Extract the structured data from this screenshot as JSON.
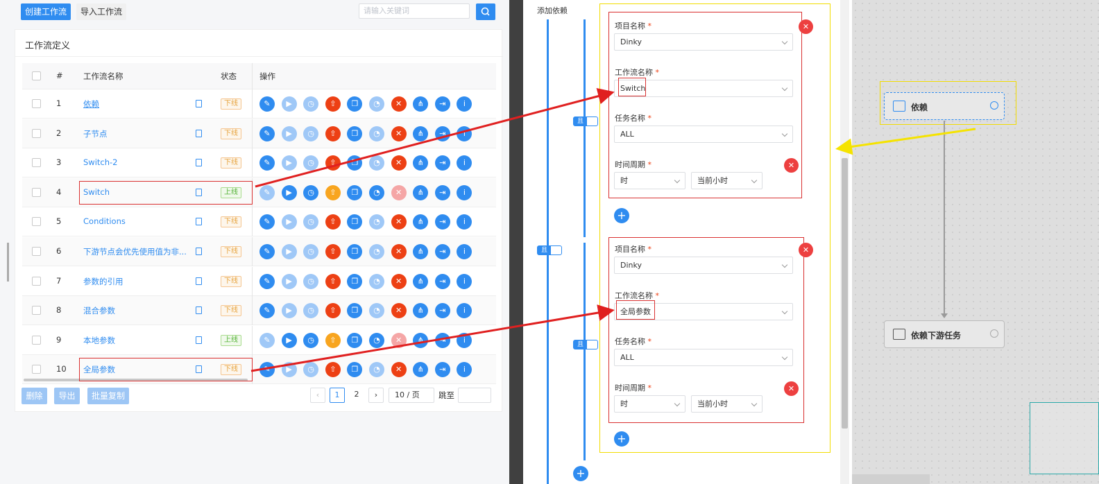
{
  "toolbar": {
    "create_label": "创建工作流",
    "import_label": "导入工作流",
    "search_placeholder": "请输入关键词"
  },
  "table": {
    "title": "工作流定义",
    "headers": {
      "index": "#",
      "name": "工作流名称",
      "status": "状态",
      "ops": "操作"
    },
    "rows": [
      {
        "index": "1",
        "name": "依赖",
        "status": "下线",
        "online": false
      },
      {
        "index": "2",
        "name": "子节点",
        "status": "下线",
        "online": false
      },
      {
        "index": "3",
        "name": "Switch-2",
        "status": "下线",
        "online": false
      },
      {
        "index": "4",
        "name": "Switch",
        "status": "上线",
        "online": true
      },
      {
        "index": "5",
        "name": "Conditions",
        "status": "下线",
        "online": false
      },
      {
        "index": "6",
        "name": "下游节点会优先使用值为非...",
        "status": "下线",
        "online": false
      },
      {
        "index": "7",
        "name": "参数的引用",
        "status": "下线",
        "online": false
      },
      {
        "index": "8",
        "name": "混合参数",
        "status": "下线",
        "online": false
      },
      {
        "index": "9",
        "name": "本地参数",
        "status": "上线",
        "online": true
      },
      {
        "index": "10",
        "name": "全局参数",
        "status": "下线",
        "online": false
      }
    ]
  },
  "bulk_actions": {
    "delete": "删除",
    "export": "导出",
    "batch_copy": "批量复制"
  },
  "pagination": {
    "page1": "1",
    "page2": "2",
    "page_size": "10 / 页",
    "jump_label": "跳至"
  },
  "dependency": {
    "header": "添加依赖",
    "relation_label": "且",
    "groups": [
      {
        "project_label": "项目名称",
        "project_value": "Dinky",
        "workflow_label": "工作流名称",
        "workflow_value": "Switch",
        "task_label": "任务名称",
        "task_value": "ALL",
        "period_label": "时间周期",
        "period_unit": "时",
        "period_value": "当前小时"
      },
      {
        "project_label": "项目名称",
        "project_value": "Dinky",
        "workflow_label": "工作流名称",
        "workflow_value": "全局参数",
        "task_label": "任务名称",
        "task_value": "ALL",
        "period_label": "时间周期",
        "period_unit": "时",
        "period_value": "当前小时"
      }
    ]
  },
  "canvas": {
    "node_dependent": "依赖",
    "node_downstream": "依赖下游任务"
  },
  "colors": {
    "primary": "#2f8cf0",
    "danger": "#ed4014",
    "annotation_red": "#e02020",
    "annotation_yellow": "#f5e300"
  },
  "icons": {
    "edit": "edit-icon",
    "run": "play-icon",
    "timing": "clock-icon",
    "publish": "upload-icon",
    "copy": "copy-icon",
    "cron": "cron-icon",
    "delete": "trash-icon",
    "tree": "tree-icon",
    "export": "export-icon",
    "info": "info-icon"
  }
}
